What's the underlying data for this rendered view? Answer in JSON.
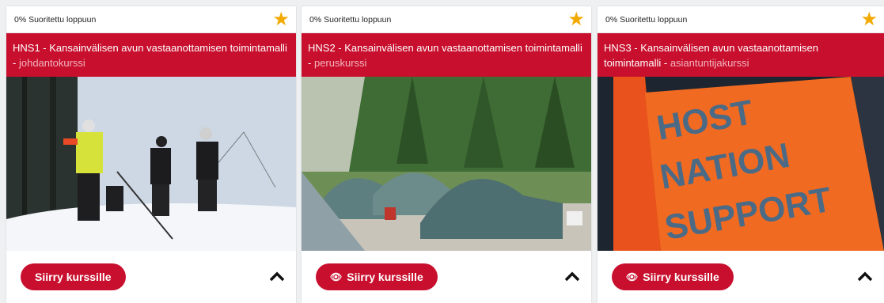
{
  "cards": [
    {
      "progress": "0% Suoritettu loppuun",
      "title_main": "HNS1 - Kansainvälisen avun vastaanottamisen toimintamalli -",
      "title_suffix": "johdantokurssi",
      "button_label": "Siirry kurssille",
      "show_eye_icon": false,
      "image_icon": "snow-hikers-image"
    },
    {
      "progress": "0% Suoritettu loppuun",
      "title_main": "HNS2 - Kansainvälisen avun vastaanottamisen toimintamalli -",
      "title_suffix": "peruskurssi",
      "button_label": "Siirry kurssille",
      "show_eye_icon": true,
      "image_icon": "tent-camp-image"
    },
    {
      "progress": "0% Suoritettu loppuun",
      "title_main": "HNS3 - Kansainvälisen avun vastaanottamisen toimintamalli -",
      "title_suffix": "asiantuntijakurssi",
      "button_label": "Siirry kurssille",
      "show_eye_icon": true,
      "image_icon": "hns-vest-image",
      "image_text": [
        "HOST",
        "NATION",
        "SUPPORT"
      ]
    }
  ],
  "colors": {
    "accent": "#c8102e",
    "star": "#f2a900"
  }
}
